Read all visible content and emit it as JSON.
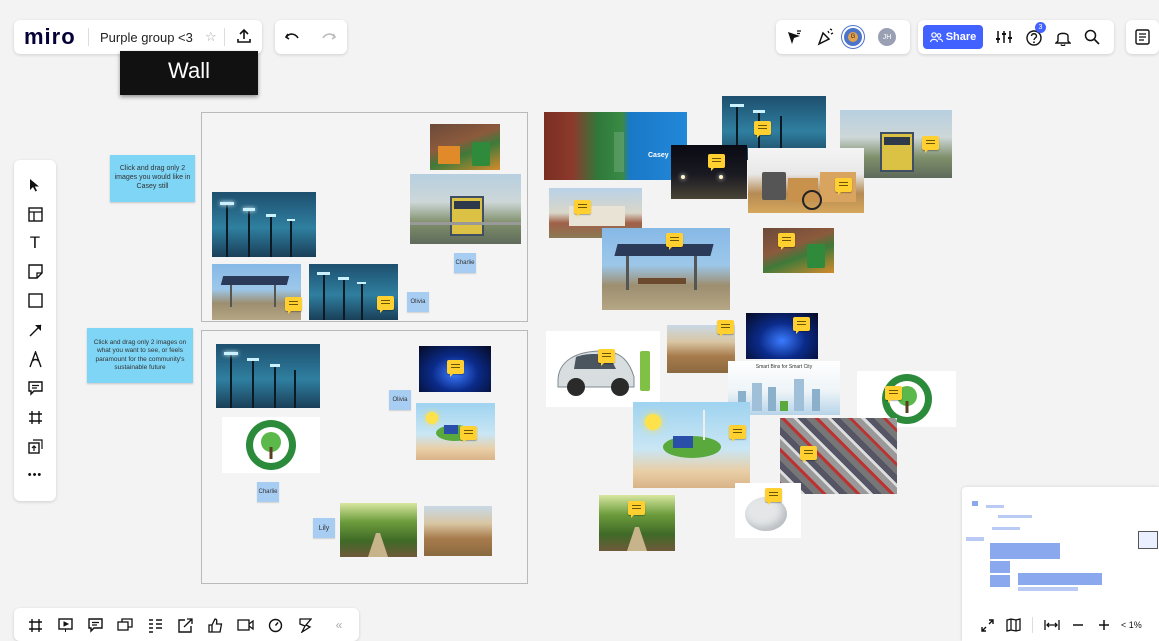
{
  "app": {
    "logo": "miro",
    "board_title": "Purple group <3"
  },
  "colors": {
    "share": "#4262ff",
    "sticky": "#7ed5f5",
    "name_tag": "#a8cdf2",
    "comment": "#ffd02f"
  },
  "wall_label": "Wall",
  "header": {
    "share_label": "Share",
    "notification_count": "3",
    "avatar_1": "G",
    "avatar_2": "JH"
  },
  "toolbar": {
    "tools": [
      "select-icon",
      "templates-icon",
      "text-icon",
      "sticky-note-icon",
      "shape-icon",
      "connection-line-icon",
      "pen-icon",
      "comment-icon",
      "frame-icon",
      "upload-icon",
      "more-icon"
    ],
    "more_label": "•••"
  },
  "bottom_toolbar": {
    "tools": [
      "frames-icon",
      "presentation-icon",
      "comments-icon",
      "cards-icon",
      "board-list-icon",
      "share-screen-icon",
      "voting-icon",
      "video-chat-icon",
      "timer-icon",
      "activity-icon"
    ],
    "collapse_label": "«"
  },
  "stickies": {
    "instruction_1": "Click and drag only 2 images you would like in Casey still",
    "instruction_2": "Click and drag only 2 images on what you want to see, or feels paramount for the community's sustainable future"
  },
  "name_tags": {
    "charlie_1": "Charlie",
    "olivia_1": "Olivia",
    "olivia_2": "Olivia",
    "charlie_2": "Charlie",
    "lily": "Lily"
  },
  "image_labels": {
    "carbon_neutral": "CARBON NEUTRAL",
    "smart_city": "Smart Bins for Smart City",
    "casey": "Casey"
  },
  "zoom": {
    "level": "< 1%"
  }
}
